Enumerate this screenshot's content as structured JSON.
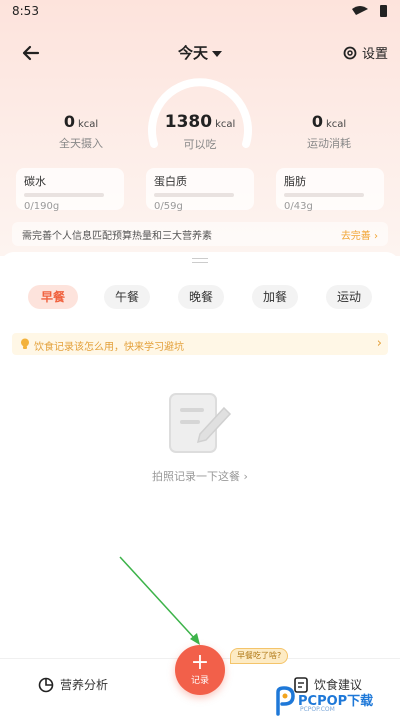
{
  "status_bar": {
    "time": "8:53"
  },
  "header": {
    "title": "今天",
    "settings_label": "设置"
  },
  "summary": {
    "intake": {
      "value": "0",
      "unit": "kcal",
      "label": "全天摄入"
    },
    "remaining": {
      "value": "1380",
      "unit": "kcal",
      "label": "可以吃"
    },
    "burned": {
      "value": "0",
      "unit": "kcal",
      "label": "运动消耗"
    }
  },
  "macros": [
    {
      "name": "碳水",
      "value": "0/190g",
      "progress": 0
    },
    {
      "name": "蛋白质",
      "value": "0/59g",
      "progress": 0
    },
    {
      "name": "脂肪",
      "value": "0/43g",
      "progress": 0
    }
  ],
  "profile_hint": {
    "text": "需完善个人信息匹配预算热量和三大营养素",
    "link": "去完善 ›"
  },
  "meal_tabs": [
    "早餐",
    "午餐",
    "晚餐",
    "加餐",
    "运动"
  ],
  "active_tab": 0,
  "tip": {
    "text": "饮食记录该怎么用，快来学习避坑",
    "arrow": "›"
  },
  "empty_state": {
    "text": "拍照记录一下这餐 ›"
  },
  "bottom_nav": {
    "left_label": "营养分析",
    "fab_label": "记录",
    "fab_symbol": "+",
    "bubble": "早餐吃了啥?",
    "right_label": "饮食建议"
  },
  "watermark": {
    "brand": "PCPOP下载",
    "sub": "PCPOP.COM"
  },
  "colors": {
    "accent": "#f2604a",
    "tab_active": "#f0623f",
    "tip": "#e3a03a",
    "link": "#f1a432",
    "arrow": "#3db34a"
  }
}
